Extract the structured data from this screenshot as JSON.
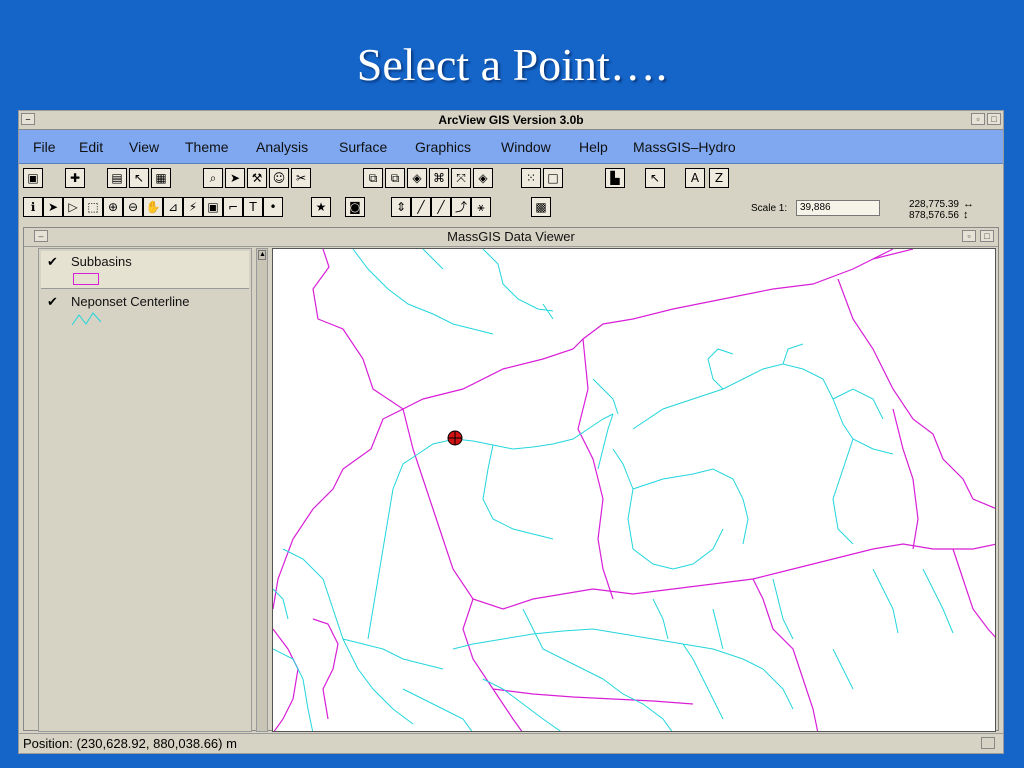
{
  "slide": {
    "title": "Select a Point…."
  },
  "window": {
    "title": "ArcView GIS Version 3.0b"
  },
  "menu": {
    "file": "File",
    "edit": "Edit",
    "view": "View",
    "theme": "Theme",
    "analysis": "Analysis",
    "surface": "Surface",
    "graphics": "Graphics",
    "window": "Window",
    "help": "Help",
    "massgis_hydro": "MassGIS–Hydro"
  },
  "toolbar": {
    "text_tool": "T",
    "label_a": "A",
    "label_z": "Z"
  },
  "scale": {
    "label": "Scale 1:",
    "value": "39,886",
    "x_coord": "228,775.39",
    "y_coord": "878,576.56"
  },
  "viewer": {
    "title": "MassGIS Data Viewer",
    "layers": [
      {
        "name": "Subbasins",
        "checked": "✔"
      },
      {
        "name": "Neponset Centerline",
        "checked": "✔"
      }
    ]
  },
  "status": {
    "position": "Position: (230,628.92, 880,038.66) m"
  },
  "colors": {
    "subbasin": "#d81fd8",
    "stream": "#22d6dc",
    "point": "#d11212",
    "background": "#1565c8"
  },
  "icons": {
    "save": "save-icon",
    "add_theme": "add-theme-icon",
    "select_point": "selected-point-icon"
  }
}
